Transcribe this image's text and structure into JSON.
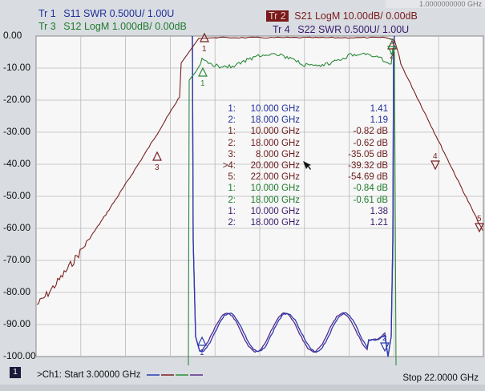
{
  "header": {
    "tr1": {
      "label": "Tr  1",
      "text": "S11 SWR 0.500U/  1.00U",
      "color": "#1f2f9a"
    },
    "tr3": {
      "label": "Tr  3",
      "text": "S12 LogM 1.000dB/  0.00dB",
      "color": "#1f7a2c"
    },
    "tr2": {
      "label": "Tr  2",
      "text": "S21 LogM 10.00dB/  0.00dB",
      "color": "#7a1a1a"
    },
    "tr4": {
      "label": "Tr  4",
      "text": "S22 SWR 0.500U/  1.00U",
      "color": "#3a1a6a"
    },
    "corner_freq": "1.0000000000 GHz"
  },
  "y_axis": {
    "labels": [
      "0.00",
      "-10.00",
      "-20.00",
      "-30.00",
      "-40.00",
      "-50.00",
      "-60.00",
      "-70.00",
      "-80.00",
      "-90.00",
      "-100.00"
    ]
  },
  "markers": [
    {
      "idx": "1:",
      "freq": "10.000 GHz",
      "val": "1.41",
      "color": "#1f2f9a"
    },
    {
      "idx": "2:",
      "freq": "18.000 GHz",
      "val": "1.19",
      "color": "#1f2f9a"
    },
    {
      "idx": "1:",
      "freq": "10.000 GHz",
      "val": "-0.82 dB",
      "color": "#6a1a1a"
    },
    {
      "idx": "2:",
      "freq": "18.000 GHz",
      "val": "-0.62 dB",
      "color": "#6a1a1a"
    },
    {
      "idx": "3:",
      "freq": "8.000 GHz",
      "val": "-35.05 dB",
      "color": "#6a1a1a"
    },
    {
      "idx": ">4:",
      "freq": "20.000 GHz",
      "val": "-39.32 dB",
      "color": "#6a1a1a"
    },
    {
      "idx": "5:",
      "freq": "22.000 GHz",
      "val": "-54.69 dB",
      "color": "#6a1a1a"
    },
    {
      "idx": "1:",
      "freq": "10.000 GHz",
      "val": "-0.84 dB",
      "color": "#1f7a2c"
    },
    {
      "idx": "2:",
      "freq": "18.000 GHz",
      "val": "-0.61 dB",
      "color": "#1f7a2c"
    },
    {
      "idx": "1:",
      "freq": "10.000 GHz",
      "val": "1.38",
      "color": "#3a1a6a"
    },
    {
      "idx": "2:",
      "freq": "18.000 GHz",
      "val": "1.21",
      "color": "#3a1a6a"
    }
  ],
  "plot_markers": [
    "1",
    "2",
    "3",
    "4",
    "5"
  ],
  "footer": {
    "channel": "1",
    "start": ">Ch1:  Start  3.00000 GHz",
    "stop": "Stop  22.0000 GHz"
  }
}
